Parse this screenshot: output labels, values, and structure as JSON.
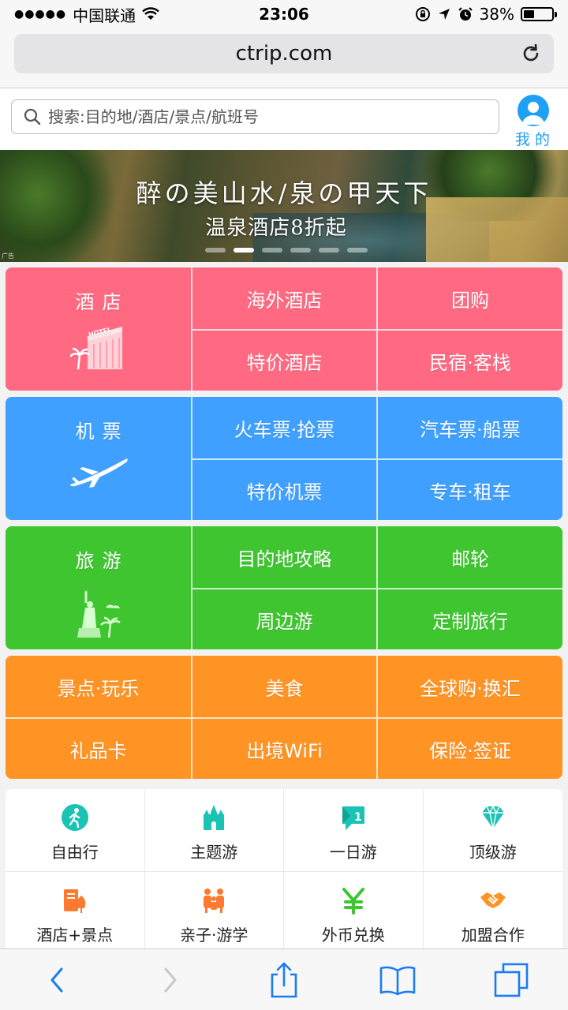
{
  "status": {
    "carrier": "中国联通",
    "time": "23:06",
    "battery": "38%",
    "battery_level": 0.38
  },
  "browser": {
    "url": "ctrip.com"
  },
  "search": {
    "placeholder": "搜索:目的地/酒店/景点/航班号"
  },
  "me_label": "我的",
  "banner": {
    "title": "醉の美山水/泉の甲天下",
    "subtitle": "温泉酒店8折起",
    "ad": "广告",
    "active_slide": 1,
    "slide_count": 6
  },
  "hotel": {
    "main": "酒店",
    "items": [
      "海外酒店",
      "团购",
      "特价酒店",
      "民宿·客栈"
    ]
  },
  "flight": {
    "main": "机票",
    "items": [
      "火车票·抢票",
      "汽车票·船票",
      "特价机票",
      "专车·租车"
    ]
  },
  "travel": {
    "main": "旅游",
    "items": [
      "目的地攻略",
      "邮轮",
      "周边游",
      "定制旅行"
    ]
  },
  "more": {
    "items": [
      "景点·玩乐",
      "美食",
      "全球购·换汇",
      "礼品卡",
      "出境WiFi",
      "保险·签证"
    ]
  },
  "services": [
    {
      "label": "自由行",
      "icon": "walker-icon"
    },
    {
      "label": "主题游",
      "icon": "castle-icon"
    },
    {
      "label": "一日游",
      "icon": "flag-one-icon"
    },
    {
      "label": "顶级游",
      "icon": "diamond-icon"
    },
    {
      "label": "酒店+景点",
      "icon": "hotel-sight-icon"
    },
    {
      "label": "亲子·游学",
      "icon": "family-icon"
    },
    {
      "label": "外币兑换",
      "icon": "yen-icon"
    },
    {
      "label": "加盟合作",
      "icon": "handshake-icon"
    }
  ],
  "colors": {
    "hotel": "#ff6a82",
    "flight": "#3fa0ff",
    "travel": "#3ec52f",
    "more": "#ff9424",
    "accent": "#1ea0f5"
  }
}
